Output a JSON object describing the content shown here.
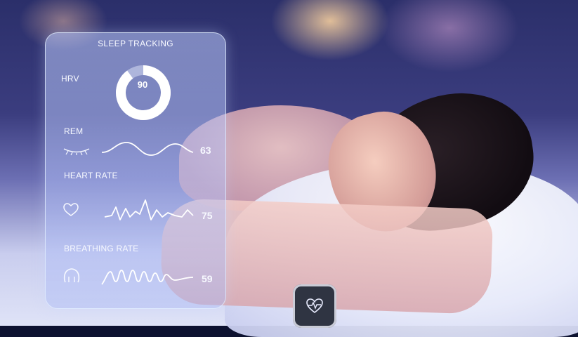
{
  "panel": {
    "title": "SLEEP TRACKING",
    "hrv": {
      "label": "HRV",
      "value": "90",
      "fraction": 0.9
    },
    "rem": {
      "label": "REM",
      "value": "63",
      "icon": "closed-eye-icon"
    },
    "heart_rate": {
      "label": "HEART RATE",
      "value": "75",
      "icon": "heart-icon"
    },
    "breathing_rate": {
      "label": "BREATHING RATE",
      "value": "59",
      "icon": "lungs-icon"
    }
  },
  "watch": {
    "icon": "heart-pulse-icon"
  },
  "colors": {
    "panel_glass": "#bccdff",
    "text": "#f7f9ff",
    "accent_line": "#ffffff"
  }
}
